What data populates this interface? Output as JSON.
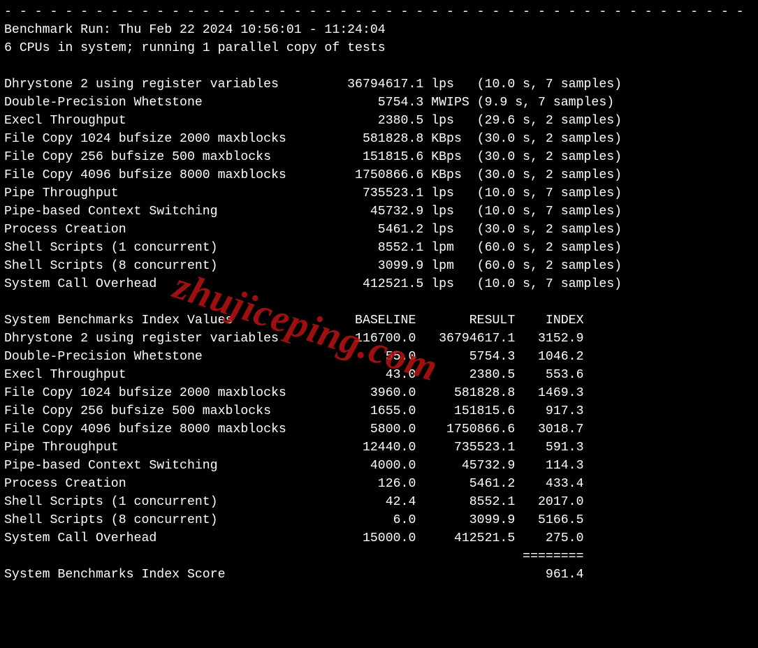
{
  "watermark": "zhujiceping.com",
  "divider": "- - - - - - - - - - - - - - - - - - - - - - - - - - - - - - - - - - - - - - - - - - - - - - - - -",
  "header": {
    "run_line": "Benchmark Run: Thu Feb 22 2024 10:56:01 - 11:24:04",
    "cpu_line": "6 CPUs in system; running 1 parallel copy of tests"
  },
  "tests": [
    {
      "name": "Dhrystone 2 using register variables",
      "value": "36794617.1",
      "unit": "lps",
      "timing": "(10.0 s, 7 samples)"
    },
    {
      "name": "Double-Precision Whetstone",
      "value": "5754.3",
      "unit": "MWIPS",
      "timing": "(9.9 s, 7 samples)"
    },
    {
      "name": "Execl Throughput",
      "value": "2380.5",
      "unit": "lps",
      "timing": "(29.6 s, 2 samples)"
    },
    {
      "name": "File Copy 1024 bufsize 2000 maxblocks",
      "value": "581828.8",
      "unit": "KBps",
      "timing": "(30.0 s, 2 samples)"
    },
    {
      "name": "File Copy 256 bufsize 500 maxblocks",
      "value": "151815.6",
      "unit": "KBps",
      "timing": "(30.0 s, 2 samples)"
    },
    {
      "name": "File Copy 4096 bufsize 8000 maxblocks",
      "value": "1750866.6",
      "unit": "KBps",
      "timing": "(30.0 s, 2 samples)"
    },
    {
      "name": "Pipe Throughput",
      "value": "735523.1",
      "unit": "lps",
      "timing": "(10.0 s, 7 samples)"
    },
    {
      "name": "Pipe-based Context Switching",
      "value": "45732.9",
      "unit": "lps",
      "timing": "(10.0 s, 7 samples)"
    },
    {
      "name": "Process Creation",
      "value": "5461.2",
      "unit": "lps",
      "timing": "(30.0 s, 2 samples)"
    },
    {
      "name": "Shell Scripts (1 concurrent)",
      "value": "8552.1",
      "unit": "lpm",
      "timing": "(60.0 s, 2 samples)"
    },
    {
      "name": "Shell Scripts (8 concurrent)",
      "value": "3099.9",
      "unit": "lpm",
      "timing": "(60.0 s, 2 samples)"
    },
    {
      "name": "System Call Overhead",
      "value": "412521.5",
      "unit": "lps",
      "timing": "(10.0 s, 7 samples)"
    }
  ],
  "index_header": {
    "title": "System Benchmarks Index Values",
    "col_baseline": "BASELINE",
    "col_result": "RESULT",
    "col_index": "INDEX"
  },
  "index_rows": [
    {
      "name": "Dhrystone 2 using register variables",
      "baseline": "116700.0",
      "result": "36794617.1",
      "index": "3152.9"
    },
    {
      "name": "Double-Precision Whetstone",
      "baseline": "55.0",
      "result": "5754.3",
      "index": "1046.2"
    },
    {
      "name": "Execl Throughput",
      "baseline": "43.0",
      "result": "2380.5",
      "index": "553.6"
    },
    {
      "name": "File Copy 1024 bufsize 2000 maxblocks",
      "baseline": "3960.0",
      "result": "581828.8",
      "index": "1469.3"
    },
    {
      "name": "File Copy 256 bufsize 500 maxblocks",
      "baseline": "1655.0",
      "result": "151815.6",
      "index": "917.3"
    },
    {
      "name": "File Copy 4096 bufsize 8000 maxblocks",
      "baseline": "5800.0",
      "result": "1750866.6",
      "index": "3018.7"
    },
    {
      "name": "Pipe Throughput",
      "baseline": "12440.0",
      "result": "735523.1",
      "index": "591.3"
    },
    {
      "name": "Pipe-based Context Switching",
      "baseline": "4000.0",
      "result": "45732.9",
      "index": "114.3"
    },
    {
      "name": "Process Creation",
      "baseline": "126.0",
      "result": "5461.2",
      "index": "433.4"
    },
    {
      "name": "Shell Scripts (1 concurrent)",
      "baseline": "42.4",
      "result": "8552.1",
      "index": "2017.0"
    },
    {
      "name": "Shell Scripts (8 concurrent)",
      "baseline": "6.0",
      "result": "3099.9",
      "index": "5166.5"
    },
    {
      "name": "System Call Overhead",
      "baseline": "15000.0",
      "result": "412521.5",
      "index": "275.0"
    }
  ],
  "footer": {
    "rule": "========",
    "score_label": "System Benchmarks Index Score",
    "score_value": "961.4"
  },
  "cols": {
    "name_w": 41,
    "value_w": 14,
    "unit_w": 6,
    "baseline_w": 13,
    "result_w": 13,
    "index_w": 9
  }
}
